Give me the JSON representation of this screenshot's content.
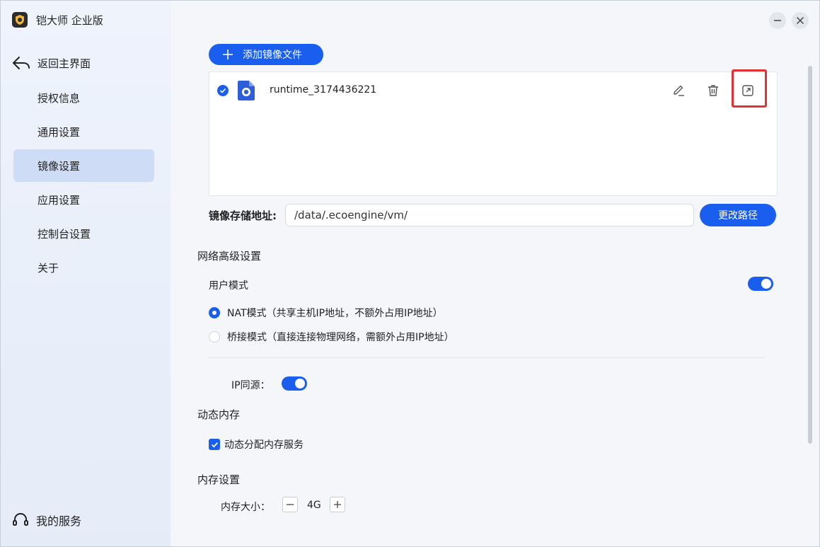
{
  "app": {
    "title": "铠大师 企业版"
  },
  "sidebar": {
    "back_label": "返回主界面",
    "items": [
      {
        "label": "授权信息"
      },
      {
        "label": "通用设置"
      },
      {
        "label": "镜像设置"
      },
      {
        "label": "应用设置"
      },
      {
        "label": "控制台设置"
      },
      {
        "label": "关于"
      }
    ],
    "active_item": "镜像设置",
    "service_label": "我的服务"
  },
  "main": {
    "add_image_label": "添加镜像文件",
    "files": [
      {
        "name": "runtime_3174436221",
        "checked": true
      }
    ],
    "storage": {
      "label": "镜像存储地址:",
      "path": "/data/.ecoengine/vm/",
      "change_btn": "更改路径"
    },
    "network": {
      "title": "网络高级设置",
      "user_mode_label": "用户模式",
      "user_mode_on": true,
      "nat_label": "NAT模式（共享主机IP地址，不额外占用IP地址）",
      "bridge_label": "桥接模式（直接连接物理网络，需额外占用IP地址）",
      "selected": "NAT",
      "ip_same_label": "IP同源：",
      "ip_same_on": true
    },
    "dynamic_memory": {
      "title": "动态内存",
      "checkbox_label": "动态分配内存服务",
      "checked": true
    },
    "memory": {
      "title": "内存设置",
      "size_label": "内存大小：",
      "value": "4G"
    }
  },
  "colors": {
    "accent": "#1a5ef0",
    "sidebar_active": "#cfdcf5",
    "highlight": "#e03434"
  }
}
